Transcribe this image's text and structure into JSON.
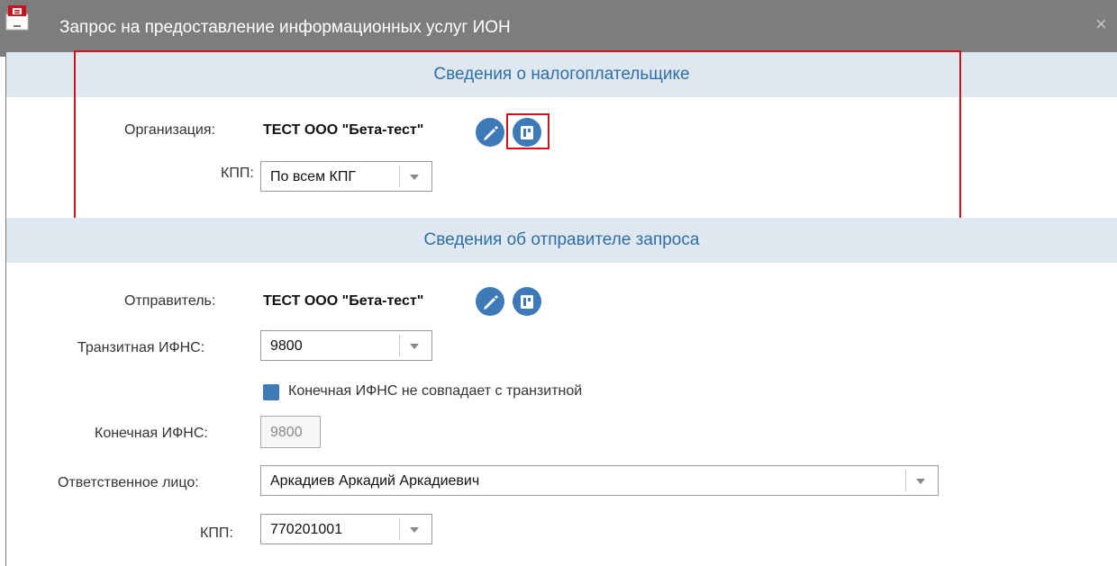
{
  "window": {
    "title": "Запрос на предоставление информационных услуг ИОН",
    "close_glyph": "×",
    "app_icon": "report-book-icon"
  },
  "taxpayer_section": {
    "header": "Сведения о налогоплательщике",
    "organization_label": "Организация:",
    "organization_value": "ТЕСТ ООО \"Бета-тест\"",
    "kpp_label": "КПП:",
    "kpp_value": "По всем КПГ",
    "edit_icon": "pencil-icon",
    "card_icon": "card-icon"
  },
  "sender_section": {
    "header": "Сведения об отправителе запроса",
    "sender_label": "Отправитель:",
    "sender_value": "ТЕСТ ООО \"Бета-тест\"",
    "transit_label": "Транзитная ИФНС:",
    "transit_value": "9800",
    "checkbox_label": "Конечная ИФНС не совпадает с транзитной",
    "checkbox_checked": true,
    "final_label": "Конечная ИФНС:",
    "final_value": "9800",
    "responsible_label": "Ответственное лицо:",
    "responsible_value": "Аркадиев Аркадий Аркадиевич",
    "kpp_label": "КПП:",
    "kpp_value": "770201001"
  },
  "colors": {
    "accent": "#3e7ab8",
    "section_header_bg": "#dfe8f1",
    "section_header_text": "#2f6fa3",
    "highlight": "#d0131b",
    "titlebar": "#7d7d7d"
  }
}
